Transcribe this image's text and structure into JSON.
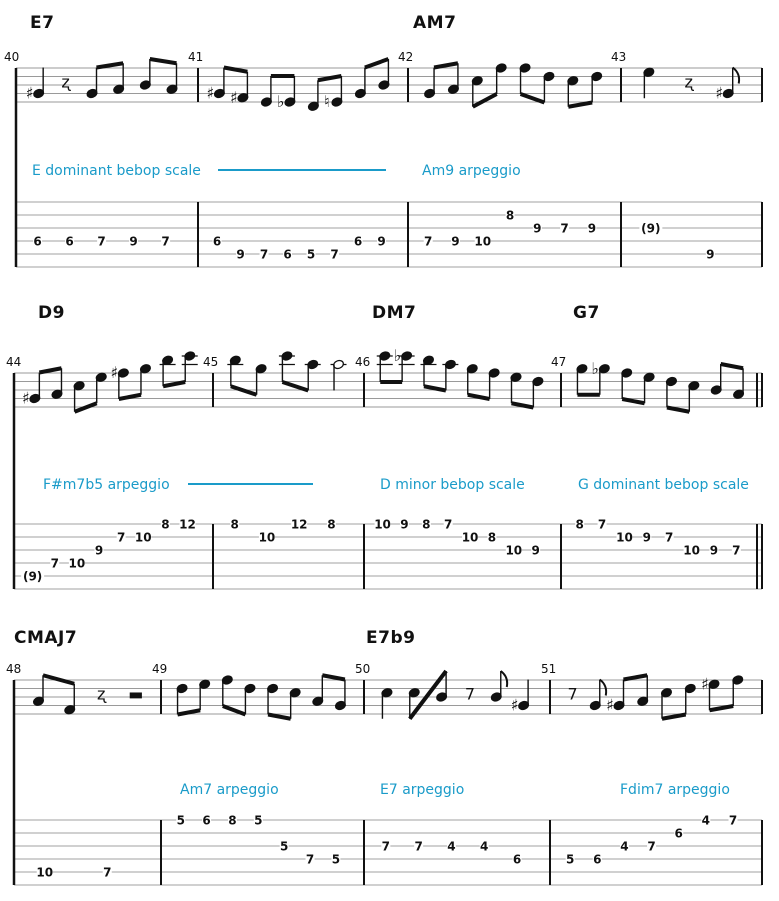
{
  "colors": {
    "annotation": "#1a9bc9",
    "ink": "#111111"
  },
  "systems": [
    {
      "chords": [
        {
          "label": "E7",
          "measure": 40
        },
        {
          "label": "AM7",
          "measure": 42
        }
      ],
      "measures": [
        {
          "number": 40,
          "notes": [
            {
              "p": 1,
              "acc": "♯",
              "dur": "q"
            },
            {
              "rest": "q"
            },
            {
              "p": 1,
              "dur": "8",
              "beam": "a"
            },
            {
              "p": 1.5,
              "dur": "8",
              "beam": "a"
            },
            {
              "p": 2,
              "dur": "8",
              "beam": "b"
            },
            {
              "p": 1.5,
              "dur": "8",
              "beam": "b"
            }
          ],
          "tab": [
            {
              "s": 4,
              "f": "6"
            },
            {
              "s": 4,
              "f": "6"
            },
            {
              "s": 4,
              "f": "7"
            },
            {
              "s": 4,
              "f": "9"
            },
            {
              "s": 4,
              "f": "7"
            }
          ]
        },
        {
          "number": 41,
          "notes": [
            {
              "p": 1,
              "acc": "♯",
              "dur": "8",
              "beam": "a"
            },
            {
              "p": 0.5,
              "acc": "♯",
              "dur": "8",
              "beam": "a"
            },
            {
              "p": 0,
              "dur": "8",
              "beam": "b"
            },
            {
              "p": 0,
              "acc": "♭",
              "dur": "8",
              "beam": "b"
            },
            {
              "p": -0.5,
              "dur": "8",
              "beam": "c"
            },
            {
              "p": 0,
              "acc": "♮",
              "dur": "8",
              "beam": "c"
            },
            {
              "p": 1,
              "dur": "8",
              "beam": "d"
            },
            {
              "p": 2,
              "dur": "8",
              "beam": "d"
            }
          ],
          "tab": [
            {
              "s": 4,
              "f": "6"
            },
            {
              "s": 5,
              "f": "9"
            },
            {
              "s": 5,
              "f": "7"
            },
            {
              "s": 5,
              "f": "6"
            },
            {
              "s": 5,
              "f": "5"
            },
            {
              "s": 5,
              "f": "7"
            },
            {
              "s": 4,
              "f": "6"
            },
            {
              "s": 4,
              "f": "9"
            }
          ]
        },
        {
          "number": 42,
          "notes": [
            {
              "p": 1,
              "dur": "8",
              "beam": "a"
            },
            {
              "p": 1.5,
              "dur": "8",
              "beam": "a"
            },
            {
              "p": 2.5,
              "dur": "8",
              "beam": "b"
            },
            {
              "p": 4,
              "dur": "8",
              "beam": "b"
            },
            {
              "p": 4,
              "dur": "8",
              "beam": "c"
            },
            {
              "p": 3,
              "dur": "8",
              "beam": "c"
            },
            {
              "p": 2.5,
              "dur": "8",
              "beam": "d"
            },
            {
              "p": 3,
              "dur": "8",
              "beam": "d"
            }
          ],
          "tab": [
            {
              "s": 4,
              "f": "7"
            },
            {
              "s": 4,
              "f": "9"
            },
            {
              "s": 4,
              "f": "10"
            },
            {
              "s": 2,
              "f": "8"
            },
            {
              "s": 3,
              "f": "9"
            },
            {
              "s": 3,
              "f": "7"
            },
            {
              "s": 3,
              "f": "9"
            }
          ]
        },
        {
          "number": 43,
          "notes": [
            {
              "p": 3.5,
              "dur": "h"
            },
            {
              "rest": "q."
            },
            {
              "p": 1,
              "acc": "♯",
              "dur": "8"
            }
          ],
          "tab": [
            {
              "s": 3,
              "f": "(9)"
            },
            {
              "s": 5,
              "f": "9"
            }
          ]
        }
      ],
      "annotations": [
        {
          "text": "E dominant bebop scale",
          "line": true
        },
        {
          "text": "Am9 arpeggio",
          "line": false
        }
      ]
    },
    {
      "chords": [
        {
          "label": "D9",
          "measure": 44
        },
        {
          "label": "DM7",
          "measure": 46
        },
        {
          "label": "G7",
          "measure": 47
        }
      ],
      "measures": [
        {
          "number": 44,
          "notes": [
            {
              "p": 1,
              "acc": "♯",
              "dur": "8",
              "beam": "a"
            },
            {
              "p": 1.5,
              "dur": "8",
              "beam": "a"
            },
            {
              "p": 2.5,
              "dur": "8",
              "beam": "b"
            },
            {
              "p": 3.5,
              "dur": "8",
              "beam": "b"
            },
            {
              "p": 4,
              "acc": "♯",
              "dur": "8",
              "beam": "c"
            },
            {
              "p": 4.5,
              "dur": "8",
              "beam": "c"
            },
            {
              "p": 5.5,
              "dur": "8",
              "beam": "d"
            },
            {
              "p": 6,
              "dur": "8",
              "beam": "d"
            }
          ],
          "tab": [
            {
              "s": 5,
              "f": "(9)"
            },
            {
              "s": 4,
              "f": "7"
            },
            {
              "s": 4,
              "f": "10"
            },
            {
              "s": 3,
              "f": "9"
            },
            {
              "s": 2,
              "f": "7"
            },
            {
              "s": 2,
              "f": "10"
            },
            {
              "s": 1,
              "f": "8"
            },
            {
              "s": 1,
              "f": "12"
            }
          ]
        },
        {
          "number": 45,
          "notes": [
            {
              "p": 5.5,
              "dur": "8",
              "beam": "a"
            },
            {
              "p": 4.5,
              "dur": "8",
              "beam": "a"
            },
            {
              "p": 6,
              "dur": "8",
              "beam": "b"
            },
            {
              "p": 5,
              "dur": "8",
              "beam": "b"
            },
            {
              "p": 5,
              "dur": "q",
              "open": true
            }
          ],
          "tab": [
            {
              "s": 1,
              "f": "8"
            },
            {
              "s": 2,
              "f": "10"
            },
            {
              "s": 1,
              "f": "12"
            },
            {
              "s": 1,
              "f": "8"
            }
          ]
        },
        {
          "number": 46,
          "notes": [
            {
              "p": 6,
              "dur": "8",
              "beam": "a"
            },
            {
              "p": 6,
              "acc": "♭",
              "dur": "8",
              "beam": "a"
            },
            {
              "p": 5.5,
              "dur": "8",
              "beam": "b"
            },
            {
              "p": 5,
              "dur": "8",
              "beam": "b"
            },
            {
              "p": 4.5,
              "dur": "8",
              "beam": "c"
            },
            {
              "p": 4,
              "dur": "8",
              "beam": "c"
            },
            {
              "p": 3.5,
              "dur": "8",
              "beam": "d"
            },
            {
              "p": 3,
              "dur": "8",
              "beam": "d"
            }
          ],
          "tab": [
            {
              "s": 1,
              "f": "10"
            },
            {
              "s": 1,
              "f": "9"
            },
            {
              "s": 1,
              "f": "8"
            },
            {
              "s": 1,
              "f": "7"
            },
            {
              "s": 2,
              "f": "10"
            },
            {
              "s": 2,
              "f": "8"
            },
            {
              "s": 3,
              "f": "10"
            },
            {
              "s": 3,
              "f": "9"
            }
          ]
        },
        {
          "number": 47,
          "notes": [
            {
              "p": 4.5,
              "dur": "8",
              "beam": "a"
            },
            {
              "p": 4.5,
              "acc": "♭",
              "dur": "8",
              "beam": "a"
            },
            {
              "p": 4,
              "dur": "8",
              "beam": "b"
            },
            {
              "p": 3.5,
              "dur": "8",
              "beam": "b"
            },
            {
              "p": 3,
              "dur": "8",
              "beam": "c"
            },
            {
              "p": 2.5,
              "dur": "8",
              "beam": "c"
            },
            {
              "p": 2,
              "dur": "8",
              "beam": "d"
            },
            {
              "p": 1.5,
              "dur": "8",
              "beam": "d"
            }
          ],
          "tab": [
            {
              "s": 1,
              "f": "8"
            },
            {
              "s": 1,
              "f": "7"
            },
            {
              "s": 2,
              "f": "10"
            },
            {
              "s": 2,
              "f": "9"
            },
            {
              "s": 2,
              "f": "7"
            },
            {
              "s": 3,
              "f": "10"
            },
            {
              "s": 3,
              "f": "9"
            },
            {
              "s": 3,
              "f": "7"
            }
          ],
          "final": true
        }
      ],
      "annotations": [
        {
          "text": "F#m7b5 arpeggio",
          "line": true
        },
        {
          "text": "D minor bebop scale",
          "line": false
        },
        {
          "text": "G dominant bebop scale",
          "line": false
        }
      ]
    },
    {
      "chords": [
        {
          "label": "CMAJ7",
          "measure": 48
        },
        {
          "label": "E7b9",
          "measure": 50
        }
      ],
      "measures": [
        {
          "number": 48,
          "notes": [
            {
              "p": 1.5,
              "dur": "8",
              "beam": "a"
            },
            {
              "p": 0.5,
              "dur": "8",
              "beam": "a"
            },
            {
              "rest": "q"
            },
            {
              "rest": "h"
            }
          ],
          "tab": [
            {
              "s": 5,
              "f": "10"
            },
            {
              "s": 5,
              "f": "7"
            }
          ]
        },
        {
          "number": 49,
          "notes": [
            {
              "p": 3,
              "dur": "8",
              "beam": "a"
            },
            {
              "p": 3.5,
              "dur": "8",
              "beam": "a"
            },
            {
              "p": 4,
              "dur": "8",
              "beam": "b"
            },
            {
              "p": 3,
              "dur": "8",
              "beam": "b"
            },
            {
              "p": 3,
              "dur": "8",
              "beam": "c"
            },
            {
              "p": 2.5,
              "dur": "8",
              "beam": "c"
            },
            {
              "p": 1.5,
              "dur": "8",
              "beam": "d"
            },
            {
              "p": 1,
              "dur": "8",
              "beam": "d"
            }
          ],
          "tab": [
            {
              "s": 1,
              "f": "5"
            },
            {
              "s": 1,
              "f": "6"
            },
            {
              "s": 1,
              "f": "8"
            },
            {
              "s": 1,
              "f": "5"
            },
            {
              "s": 3,
              "f": "5"
            },
            {
              "s": 4,
              "f": "7"
            },
            {
              "s": 4,
              "f": "5"
            }
          ]
        },
        {
          "number": 50,
          "notes": [
            {
              "p": 2.5,
              "dur": "q"
            },
            {
              "p": 2.5,
              "dur": "8",
              "beam": "a"
            },
            {
              "p": 2,
              "dur": "8",
              "beam": "a"
            },
            {
              "rest": "8"
            },
            {
              "p": 2,
              "dur": "8"
            },
            {
              "p": 1,
              "acc": "♯",
              "dur": "q"
            }
          ],
          "tab": [
            {
              "s": 3,
              "f": "7"
            },
            {
              "s": 3,
              "f": "7"
            },
            {
              "s": 3,
              "f": "4"
            },
            {
              "s": 3,
              "f": "4"
            },
            {
              "s": 4,
              "f": "6"
            }
          ]
        },
        {
          "number": 51,
          "notes": [
            {
              "rest": "8"
            },
            {
              "p": 1,
              "dur": "16"
            },
            {
              "p": 1,
              "acc": "♯",
              "dur": "8",
              "beam": "a"
            },
            {
              "p": 1.5,
              "dur": "8",
              "beam": "a"
            },
            {
              "p": 2.5,
              "dur": "8",
              "beam": "b"
            },
            {
              "p": 3,
              "dur": "8",
              "beam": "b"
            },
            {
              "p": 3.5,
              "acc": "♯",
              "dur": "8",
              "beam": "c"
            },
            {
              "p": 4,
              "dur": "8",
              "beam": "c"
            }
          ],
          "tab": [
            {
              "s": 4,
              "f": "5"
            },
            {
              "s": 4,
              "f": "6"
            },
            {
              "s": 3,
              "f": "4"
            },
            {
              "s": 3,
              "f": "7"
            },
            {
              "s": 2,
              "f": "6"
            },
            {
              "s": 1,
              "f": "4"
            },
            {
              "s": 1,
              "f": "7"
            }
          ]
        }
      ],
      "annotations": [
        {
          "text": "Am7 arpeggio",
          "line": false
        },
        {
          "text": "E7 arpeggio",
          "line": false
        },
        {
          "text": "Fdim7 arpeggio",
          "line": false
        }
      ]
    }
  ]
}
